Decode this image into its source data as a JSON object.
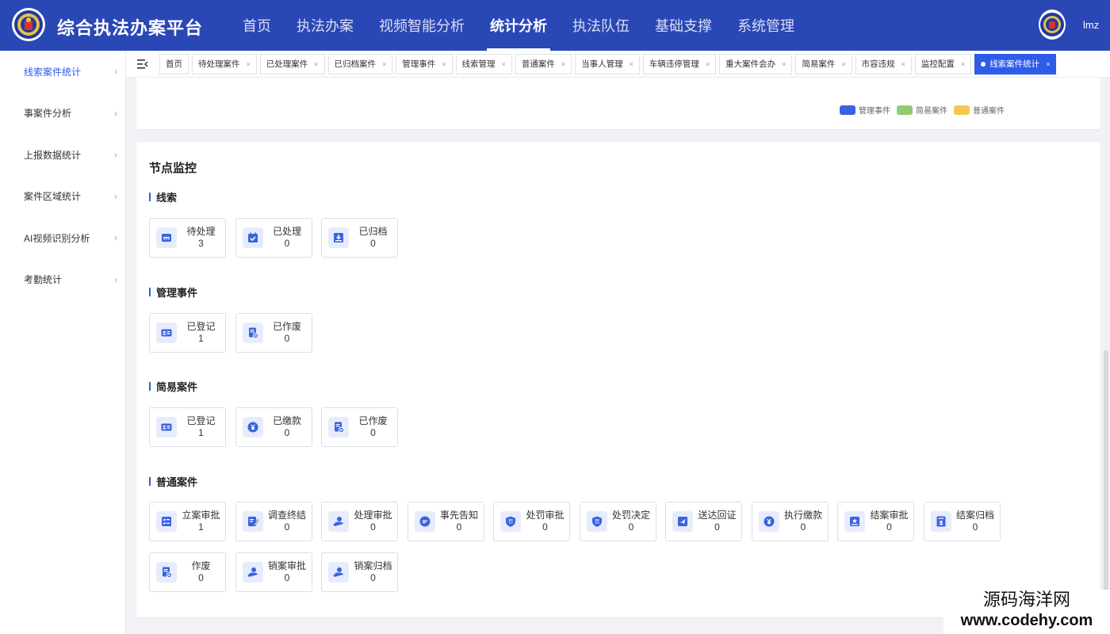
{
  "app": {
    "title": "综合执法办案平台"
  },
  "nav": [
    "首页",
    "执法办案",
    "视频智能分析",
    "统计分析",
    "执法队伍",
    "基础支撑",
    "系统管理"
  ],
  "nav_active_index": 3,
  "user": {
    "name": "lmz"
  },
  "sidebar": {
    "items": [
      {
        "label": "线索案件统计",
        "active": true
      },
      {
        "label": "事案件分析",
        "active": false
      },
      {
        "label": "上报数据统计",
        "active": false
      },
      {
        "label": "案件区域统计",
        "active": false
      },
      {
        "label": "AI视频识别分析",
        "active": false
      },
      {
        "label": "考勤统计",
        "active": false
      }
    ]
  },
  "tabs": [
    {
      "label": "首页",
      "closable": false
    },
    {
      "label": "待处理案件",
      "closable": true
    },
    {
      "label": "已处理案件",
      "closable": true
    },
    {
      "label": "已归档案件",
      "closable": true
    },
    {
      "label": "管理事件",
      "closable": true
    },
    {
      "label": "线索管理",
      "closable": true
    },
    {
      "label": "普通案件",
      "closable": true
    },
    {
      "label": "当事人管理",
      "closable": true
    },
    {
      "label": "车辆违停管理",
      "closable": true
    },
    {
      "label": "重大案件会办",
      "closable": true
    },
    {
      "label": "简易案件",
      "closable": true
    },
    {
      "label": "市容违规",
      "closable": true
    },
    {
      "label": "监控配置",
      "closable": true
    },
    {
      "label": "线索案件统计",
      "closable": true,
      "active": true
    }
  ],
  "legend": [
    {
      "label": "管理事件",
      "color": "#3a63e0"
    },
    {
      "label": "简易案件",
      "color": "#8fcc73"
    },
    {
      "label": "普通案件",
      "color": "#f7c851"
    }
  ],
  "monitor": {
    "title": "节点监控",
    "sections": [
      {
        "title": "线索",
        "items": [
          {
            "label": "待处理",
            "value": "3",
            "icon": "inbox-icon"
          },
          {
            "label": "已处理",
            "value": "0",
            "icon": "calendar-check-icon"
          },
          {
            "label": "已归档",
            "value": "0",
            "icon": "archive-icon"
          }
        ]
      },
      {
        "title": "管理事件",
        "items": [
          {
            "label": "已登记",
            "value": "1",
            "icon": "id-card-icon"
          },
          {
            "label": "已作废",
            "value": "0",
            "icon": "void-doc-icon"
          }
        ]
      },
      {
        "title": "简易案件",
        "items": [
          {
            "label": "已登记",
            "value": "1",
            "icon": "id-card-icon"
          },
          {
            "label": "已缴款",
            "value": "0",
            "icon": "payment-icon"
          },
          {
            "label": "已作废",
            "value": "0",
            "icon": "void-doc-icon"
          }
        ]
      },
      {
        "title": "普通案件",
        "items": [
          {
            "label": "立案审批",
            "value": "1",
            "icon": "checklist-icon"
          },
          {
            "label": "调查终结",
            "value": "0",
            "icon": "edit-doc-icon"
          },
          {
            "label": "处理审批",
            "value": "0",
            "icon": "user-approve-icon"
          },
          {
            "label": "事先告知",
            "value": "0",
            "icon": "message-icon"
          },
          {
            "label": "处罚审批",
            "value": "0",
            "icon": "shield-penalty-icon"
          },
          {
            "label": "处罚决定",
            "value": "0",
            "icon": "shield-penalty-icon"
          },
          {
            "label": "送达回证",
            "value": "0",
            "icon": "send-icon"
          },
          {
            "label": "执行缴款",
            "value": "0",
            "icon": "payment-icon"
          },
          {
            "label": "结案审批",
            "value": "0",
            "icon": "close-case-icon"
          },
          {
            "label": "结案归档",
            "value": "0",
            "icon": "case-archive-icon"
          },
          {
            "label": "作废",
            "value": "0",
            "icon": "void-doc-icon"
          },
          {
            "label": "销案审批",
            "value": "0",
            "icon": "user-approve-icon"
          },
          {
            "label": "销案归档",
            "value": "0",
            "icon": "user-approve-icon"
          }
        ]
      }
    ]
  },
  "watermark": {
    "name": "源码海洋网",
    "url": "www.codehy.com"
  }
}
